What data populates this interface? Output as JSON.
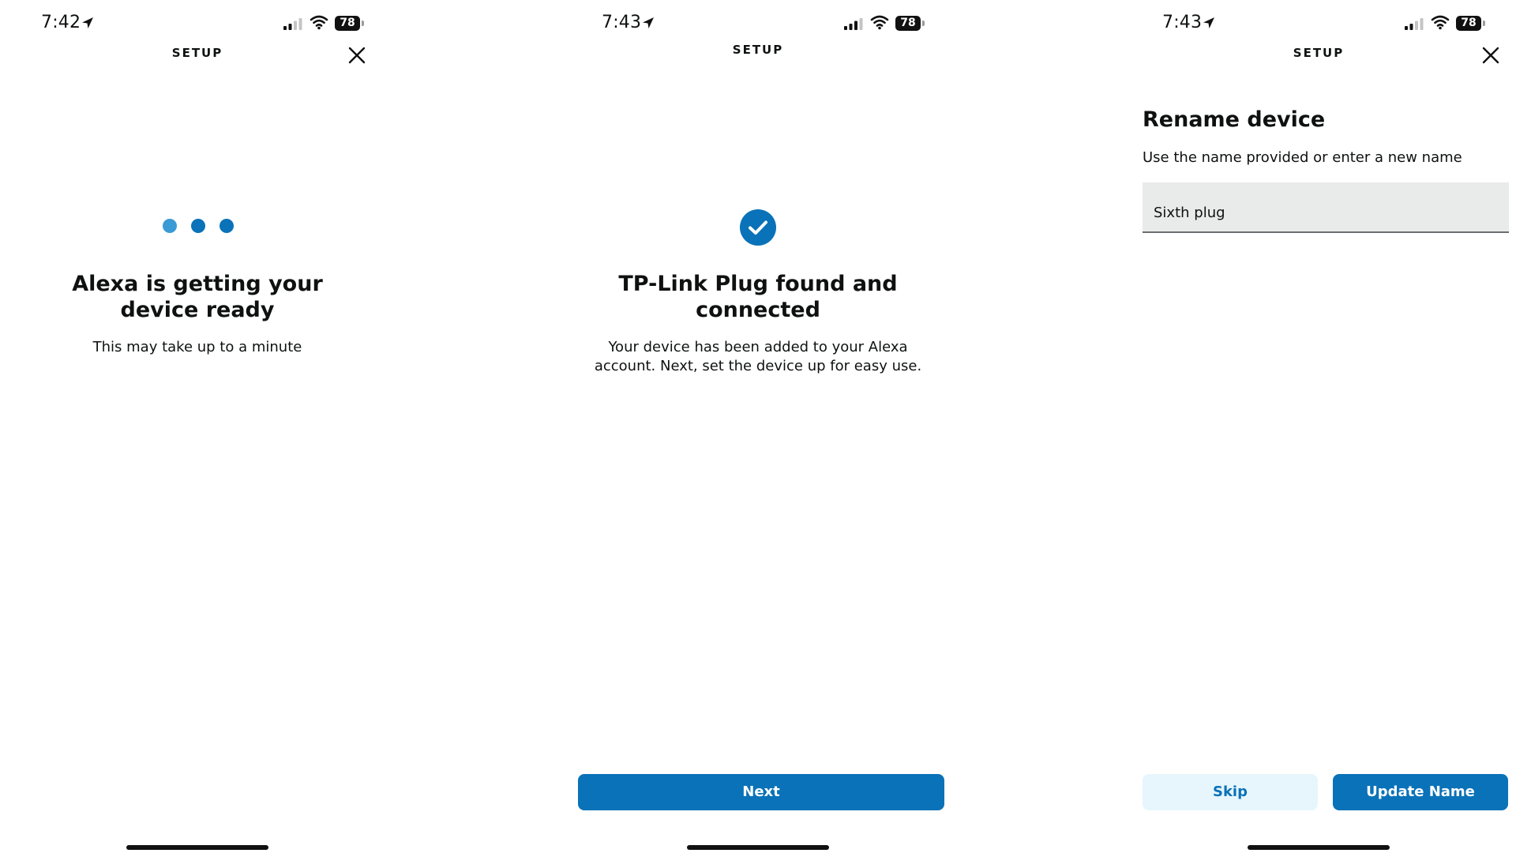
{
  "screens": [
    {
      "status": {
        "time": "7:42",
        "battery": "78"
      },
      "header": {
        "title": "SETUP"
      },
      "main": {
        "heading": "Alexa is getting your device ready",
        "subtext": "This may take up to a minute"
      }
    },
    {
      "status": {
        "time": "7:43",
        "battery": "78"
      },
      "header": {
        "title": "SETUP"
      },
      "main": {
        "heading": "TP-Link Plug found and connected",
        "subtext": "Your device has been added to your Alexa account. Next, set the device up for easy use.",
        "next_label": "Next"
      }
    },
    {
      "status": {
        "time": "7:43",
        "battery": "78"
      },
      "header": {
        "title": "SETUP"
      },
      "main": {
        "heading": "Rename device",
        "subtext": "Use the name provided or enter a new name",
        "name_value": "Sixth plug",
        "skip_label": "Skip",
        "update_label": "Update Name"
      }
    }
  ],
  "colors": {
    "accent": "#0a72b8",
    "dot_light": "#3a9ad6",
    "skip_bg": "#e7f6fd",
    "input_bg": "#e9eaea"
  },
  "icons": {
    "location": "location-arrow-icon",
    "signal": "cellular-signal-icon",
    "wifi": "wifi-icon",
    "battery": "battery-icon",
    "close": "close-icon",
    "success": "checkmark-circle-icon"
  }
}
